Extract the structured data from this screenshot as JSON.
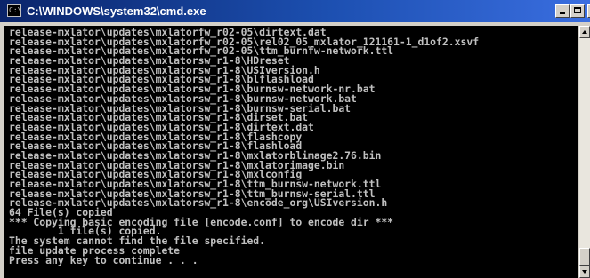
{
  "window": {
    "title": "C:\\WINDOWS\\system32\\cmd.exe",
    "icon": "cmd-console-icon",
    "icon_glyph": "C:\\",
    "controls": {
      "minimize_icon": "minimize-icon",
      "maximize_icon": "maximize-icon",
      "close_icon": "close-icon",
      "close_glyph": "×"
    }
  },
  "colors": {
    "titlebar_start": "#0a246a",
    "titlebar_end": "#3a6ee0",
    "console_bg": "#000000",
    "console_text": "#c0c0c0",
    "chrome": "#d4d0c8"
  },
  "console": {
    "lines": [
      "release-mxlator\\updates\\mxlatorfw_r02-05\\dirtext.dat",
      "release-mxlator\\updates\\mxlatorfw_r02-05\\rel02_05_mxlator_121161-1_d1of2.xsvf",
      "release-mxlator\\updates\\mxlatorfw_r02-05\\ttm_burnfw-network.ttl",
      "release-mxlator\\updates\\mxlatorsw_r1-8\\HDreset",
      "release-mxlator\\updates\\mxlatorsw_r1-8\\USIversion.h",
      "release-mxlator\\updates\\mxlatorsw_r1-8\\blflashload",
      "release-mxlator\\updates\\mxlatorsw_r1-8\\burnsw-network-nr.bat",
      "release-mxlator\\updates\\mxlatorsw_r1-8\\burnsw-network.bat",
      "release-mxlator\\updates\\mxlatorsw_r1-8\\burnsw-serial.bat",
      "release-mxlator\\updates\\mxlatorsw_r1-8\\dirset.bat",
      "release-mxlator\\updates\\mxlatorsw_r1-8\\dirtext.dat",
      "release-mxlator\\updates\\mxlatorsw_r1-8\\flashcopy",
      "release-mxlator\\updates\\mxlatorsw_r1-8\\flashload",
      "release-mxlator\\updates\\mxlatorsw_r1-8\\mxlatorblimage2.76.bin",
      "release-mxlator\\updates\\mxlatorsw_r1-8\\mxlatorimage.bin",
      "release-mxlator\\updates\\mxlatorsw_r1-8\\mxlconfig",
      "release-mxlator\\updates\\mxlatorsw_r1-8\\ttm_burnsw-network.ttl",
      "release-mxlator\\updates\\mxlatorsw_r1-8\\ttm_burnsw-serial.ttl",
      "release-mxlator\\updates\\mxlatorsw_r1-8\\encode_org\\USIversion.h",
      "64 File(s) copied",
      "*** Copying basic encoding file [encode.conf] to encode dir ***",
      "        1 file(s) copied.",
      "The system cannot find the file specified.",
      "file update process complete",
      "Press any key to continue . . ."
    ]
  },
  "scrollbar": {
    "up_icon": "scroll-up-arrow-icon",
    "down_icon": "scroll-down-arrow-icon"
  }
}
